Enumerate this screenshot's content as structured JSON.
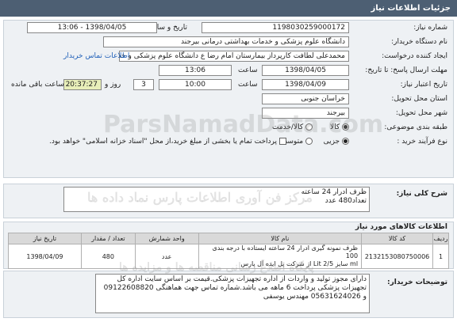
{
  "header": {
    "title": "جزئیات اطلاعات نیاز"
  },
  "fields": {
    "need_number_label": "شماره نیاز:",
    "need_number": "1198030259000172",
    "announce_label": "تاریخ و ساعت اعلان عمومی:",
    "announce_value": "1398/04/05 - 13:06",
    "buyer_label": "نام دستگاه خریدار:",
    "buyer_value": "دانشگاه علوم پزشکی و خدمات بهداشتی درمانی بیرجند",
    "creator_label": "ایجاد کننده درخواست:",
    "creator_value": "محمدعلی لطافت کارپرداز بیمارستان امام رضا ع دانشگاه علوم پزشکی و خدمات",
    "contact_link": "اطلاعات تماس خریدار",
    "send_deadline_label": "مهلت ارسال پاسخ: تا تاریخ:",
    "send_date": "1398/04/05",
    "time_label": "ساعت",
    "send_time": "13:06",
    "validity_label": "تاریخ اعتبار نیاز:",
    "validity_date": "1398/04/09",
    "validity_time": "10:00",
    "days_value": "3",
    "days_label": "روز و",
    "remaining_time": "20:37:27",
    "remaining_label": "ساعت باقی مانده",
    "province_label": "استان محل تحویل:",
    "province_value": "خراسان جنوبی",
    "city_label": "شهر محل تحویل:",
    "city_value": "بیرجند",
    "category_label": "طبقه بندی موضوعی:",
    "category_opt1": "کالا",
    "category_opt2": "کالا/خدمت",
    "process_label": "نوع فرآیند خرید :",
    "process_opt1": "جزیی",
    "process_opt2": "متوسط",
    "payment_note": "پرداخت تمام یا بخشی از مبلغ خرید،از محل \"اسناد خزانه اسلامی\" خواهد بود."
  },
  "summary": {
    "label": "شرح کلی نیاز:",
    "line1": "ظرف ادرار 24 ساعته",
    "line2": "تعداد480 عدد"
  },
  "goods": {
    "title": "اطلاعات کالاهای مورد نیاز",
    "columns": [
      "ردیف",
      "کد کالا",
      "نام کالا",
      "واحد شمارش",
      "تعداد / مقدار",
      "تاریخ نیاز"
    ],
    "rows": [
      {
        "row": "1",
        "code": "2132153080750006",
        "name_line1": "ظرف نمونه گیری ادرار 24 ساعته ایستاده با درجه بندی 100",
        "name_line2": "ml سایز 2/5 Lit از شرکت پل ایده آل پارس",
        "unit": "عدد",
        "qty": "480",
        "date": "1398/04/09"
      }
    ]
  },
  "notes": {
    "label": "توضیحات خریدار:",
    "text": "دارای مجوز تولید و واردات از اداره تجهیزات پزشکی.قیمت بر اساس سایت اداره کل تجهیزات پزشکی پرداخت 6 ماهه می باشد.شماره تماس جهت هماهنگی 09122608820 و 05631624026 مهندس یوسفی"
  },
  "watermark": {
    "line1": "مرکز فن آوری اطلاعات پارس نماد داده ها",
    "line2": "پایگاه اطلاع رسانی مناقصه ها و مزایده ها",
    "brand": "ParsNamadData.com"
  }
}
